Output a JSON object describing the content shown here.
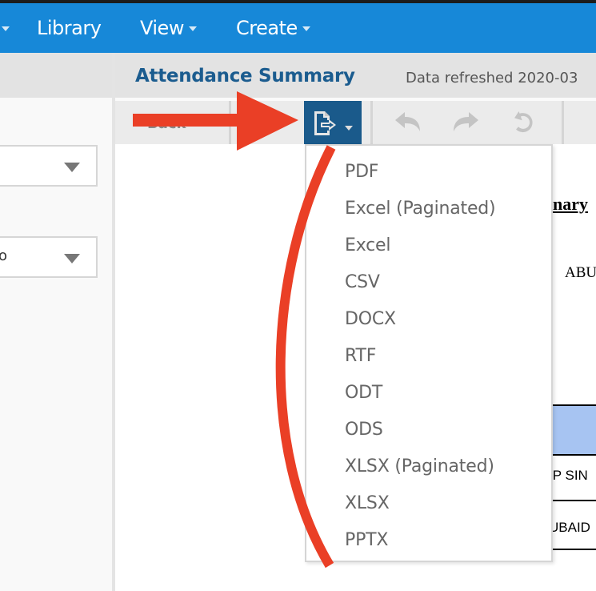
{
  "navbar": {
    "items": [
      {
        "label": "Library",
        "has_dropdown": false
      },
      {
        "label": "View",
        "has_dropdown": true
      },
      {
        "label": "Create",
        "has_dropdown": true
      }
    ],
    "background": "#1788d8"
  },
  "report_header": {
    "title": "Attendance Summary",
    "refreshed": "Data refreshed 2020-03"
  },
  "toolbar": {
    "back_label": "Back",
    "export_icon": "export-document-icon",
    "undo_icon": "undo-icon",
    "redo_icon": "redo-icon",
    "reset_icon": "reset-icon",
    "export_background": "#1a5a8b"
  },
  "left_panel": {
    "selects": [
      {
        "value": ""
      },
      {
        "value": "o"
      }
    ]
  },
  "export_menu": {
    "items": [
      "PDF",
      "Excel (Paginated)",
      "Excel",
      "CSV",
      "DOCX",
      "RTF",
      "ODT",
      "ODS",
      "XLSX (Paginated)",
      "XLSX",
      "PPTX"
    ]
  },
  "report_body": {
    "summary_fragment": "nary",
    "org_fragment": "ABU",
    "rows": [
      "/P SIN",
      "UBAID"
    ],
    "header_color": "#a7c4f2"
  },
  "annotation": {
    "color": "#ea3f26",
    "arrow": "pointing-right-at-export-button",
    "curve": "arc-along-export-menu"
  }
}
